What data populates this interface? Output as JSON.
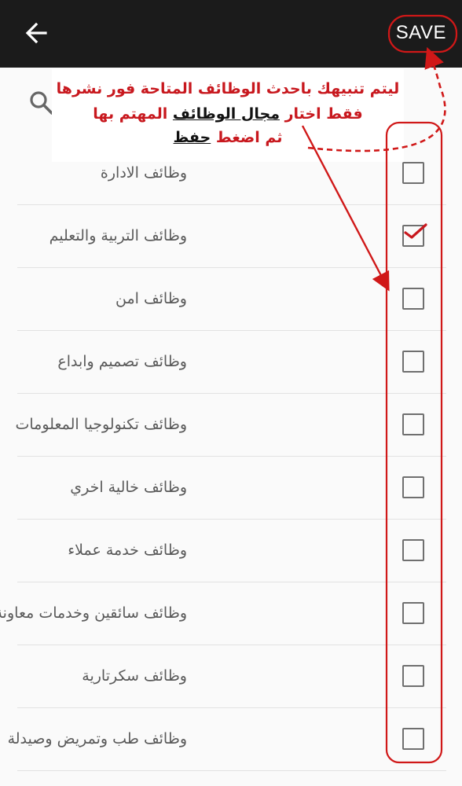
{
  "header": {
    "back_icon": "arrow-left-icon",
    "save_label": "SAVE"
  },
  "search": {
    "icon": "search-icon"
  },
  "callout": {
    "line1": "ليتم تنبيهك باحدث الوظائف المتاحة فور نشرها",
    "line2_pre": "فقط اختار ",
    "line2_emph": "مجال الوظائف",
    "line2_post": " المهتم بها",
    "line3_pre": "ثم اضغط ",
    "line3_emph": "حفظ",
    "color": "#c8181e"
  },
  "categories": [
    {
      "label": "وظائف الادارة",
      "checked": false
    },
    {
      "label": "وظائف التربية والتعليم",
      "checked": true
    },
    {
      "label": "وظائف امن",
      "checked": false
    },
    {
      "label": "وظائف تصميم وابداع",
      "checked": false
    },
    {
      "label": "وظائف تكنولوجيا المعلومات",
      "checked": false
    },
    {
      "label": "وظائف خالية اخري",
      "checked": false
    },
    {
      "label": "وظائف خدمة عملاء",
      "checked": false
    },
    {
      "label": "وظائف سائقين وخدمات معاونة",
      "checked": false
    },
    {
      "label": "وظائف سكرتارية",
      "checked": false
    },
    {
      "label": "وظائف طب وتمريض وصيدلة",
      "checked": false
    }
  ]
}
